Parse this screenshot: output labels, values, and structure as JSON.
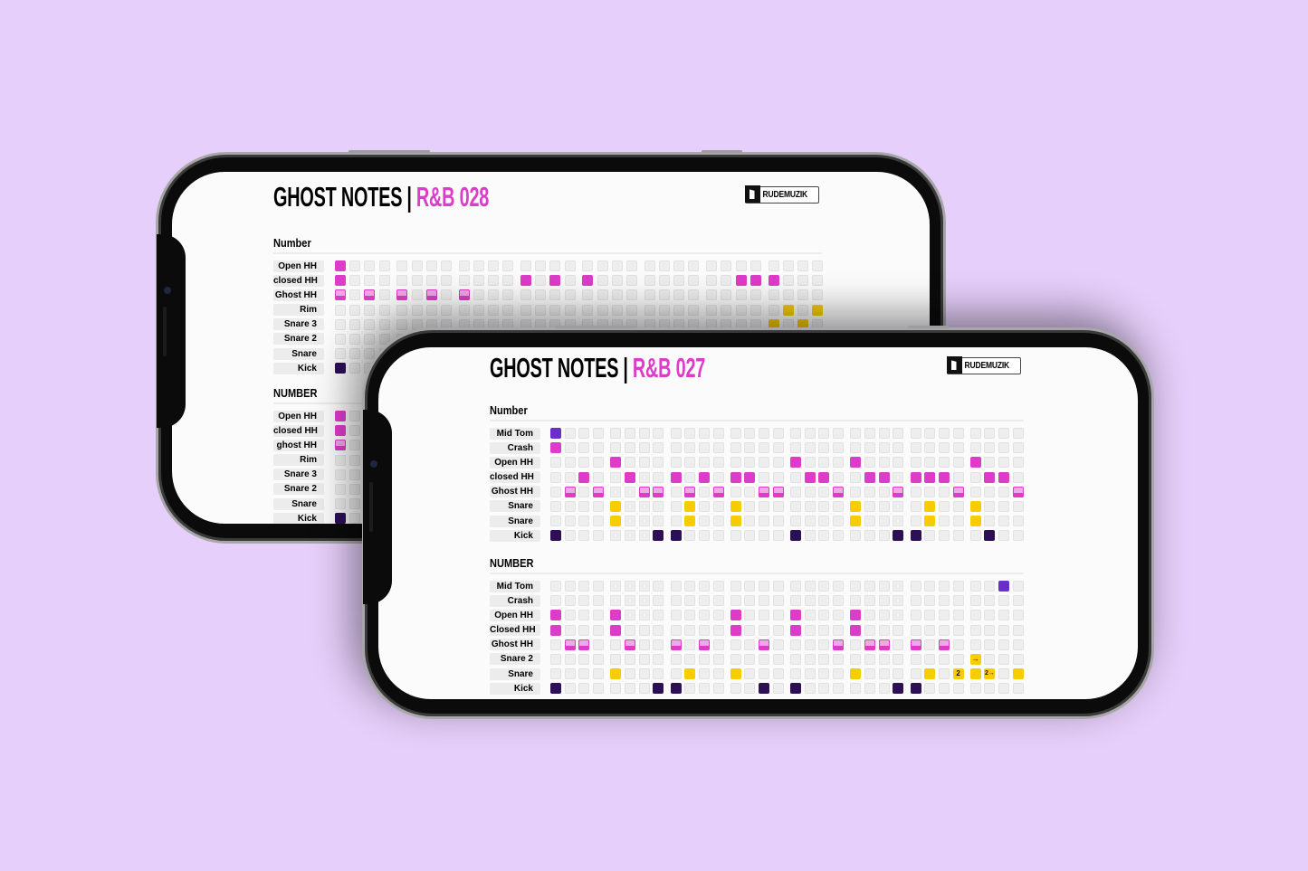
{
  "colors": {
    "background": "#e6cffa",
    "tom": "#6a2fc8",
    "pink": "#dd3cc8",
    "ghost_top": "#eea8e3",
    "snare": "#f7cd00",
    "kick": "#2d0f55",
    "empty": "#eeeeee"
  },
  "phones": [
    {
      "title": "GHOST NOTES",
      "separator": "|",
      "subtitle": "R&B 028",
      "logo": "RUDEMUZIK",
      "sections": [
        {
          "heading": "Number",
          "rows": [
            {
              "label": "Open HH",
              "kind": "pink",
              "hits": [
                0
              ]
            },
            {
              "label": "closed HH",
              "kind": "pink",
              "hits": [
                0,
                12,
                14,
                16,
                26,
                27,
                28
              ]
            },
            {
              "label": "Ghost HH",
              "kind": "ghost",
              "hits": [
                0,
                2,
                4,
                6,
                8
              ]
            },
            {
              "label": "Rim",
              "kind": "snare",
              "hits": [
                29,
                31
              ]
            },
            {
              "label": "Snare 3",
              "kind": "snare",
              "hits": [
                28,
                30
              ]
            },
            {
              "label": "Snare 2",
              "kind": "snare",
              "hits": []
            },
            {
              "label": "Snare",
              "kind": "snare",
              "hits": []
            },
            {
              "label": "Kick",
              "kind": "kick",
              "hits": [
                0
              ]
            }
          ]
        },
        {
          "heading": "NUMBER",
          "rows": [
            {
              "label": "Open HH",
              "kind": "pink",
              "hits": [
                0
              ]
            },
            {
              "label": "closed HH",
              "kind": "pink",
              "hits": [
                0
              ]
            },
            {
              "label": "ghost HH",
              "kind": "ghost",
              "hits": [
                0
              ]
            },
            {
              "label": "Rim",
              "kind": "snare",
              "hits": []
            },
            {
              "label": "Snare 3",
              "kind": "snare",
              "hits": []
            },
            {
              "label": "Snare 2",
              "kind": "snare",
              "hits": []
            },
            {
              "label": "Snare",
              "kind": "snare",
              "hits": []
            },
            {
              "label": "Kick",
              "kind": "kick",
              "hits": [
                0
              ]
            }
          ]
        }
      ]
    },
    {
      "title": "GHOST NOTES",
      "separator": "|",
      "subtitle": "R&B 027",
      "logo": "RUDEMUZIK",
      "sections": [
        {
          "heading": "Number",
          "rows": [
            {
              "label": "Mid Tom",
              "kind": "tom",
              "hits": [
                0
              ]
            },
            {
              "label": "Crash",
              "kind": "pink",
              "hits": [
                0
              ]
            },
            {
              "label": "Open HH",
              "kind": "pink",
              "hits": [
                4,
                16,
                20,
                28
              ]
            },
            {
              "label": "closed HH",
              "kind": "pink",
              "hits": [
                2,
                5,
                8,
                10,
                12,
                13,
                17,
                18,
                21,
                22,
                24,
                25,
                26,
                29,
                30
              ]
            },
            {
              "label": "Ghost HH",
              "kind": "ghost",
              "hits": [
                1,
                3,
                6,
                7,
                9,
                11,
                14,
                15,
                19,
                23,
                27,
                31
              ]
            },
            {
              "label": "Snare",
              "kind": "snare",
              "hits": [
                4,
                9,
                12,
                20,
                25,
                28
              ]
            },
            {
              "label": "Snare",
              "kind": "snare",
              "hits": [
                4,
                9,
                12,
                20,
                25,
                28
              ]
            },
            {
              "label": "Kick",
              "kind": "kick",
              "hits": [
                0,
                7,
                8,
                16,
                23,
                24,
                29
              ]
            }
          ]
        },
        {
          "heading": "NUMBER",
          "rows": [
            {
              "label": "Mid Tom",
              "kind": "tom",
              "hits": [
                30
              ]
            },
            {
              "label": "Crash",
              "kind": "pink",
              "hits": []
            },
            {
              "label": "Open HH",
              "kind": "pink",
              "hits": [
                0,
                4,
                12,
                16,
                20
              ]
            },
            {
              "label": "Closed HH",
              "kind": "pink",
              "hits": [
                0,
                4,
                12,
                16,
                20
              ]
            },
            {
              "label": "Ghost HH",
              "kind": "ghost",
              "hits": [
                1,
                2,
                5,
                8,
                10,
                14,
                19,
                21,
                22,
                24,
                26
              ]
            },
            {
              "label": "Snare 2",
              "kind": "snare",
              "hits": [
                28
              ],
              "marks": {
                "28": "→"
              }
            },
            {
              "label": "Snare",
              "kind": "snare",
              "hits": [
                4,
                9,
                12,
                20,
                25,
                27,
                28,
                29,
                31
              ],
              "marks": {
                "27": "2",
                "29": "2→"
              }
            },
            {
              "label": "Kick",
              "kind": "kick",
              "hits": [
                0,
                7,
                8,
                14,
                16,
                23,
                24
              ]
            }
          ]
        }
      ]
    }
  ]
}
